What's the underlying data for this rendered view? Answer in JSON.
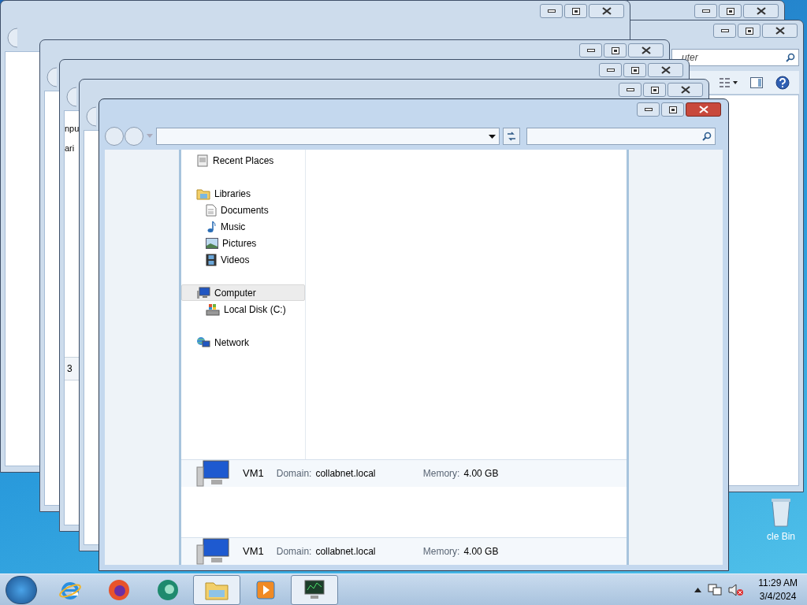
{
  "desktop": {
    "icons": [
      {
        "label": "cle Bin"
      }
    ]
  },
  "back_windows": [
    {
      "kind": "plain"
    },
    {
      "kind": "search",
      "search_placeholder": "uter"
    },
    {
      "kind": "plain"
    },
    {
      "kind": "plain"
    },
    {
      "kind": "fragments",
      "nav_fragments": [
        "npu",
        "ari"
      ],
      "status_fragment": "3"
    },
    {
      "kind": "plain"
    }
  ],
  "front_window": {
    "nav": [
      {
        "label": "Recent Places",
        "kind": "recent",
        "selected": false
      },
      {
        "label": "Libraries",
        "kind": "library",
        "selected": false,
        "children": [
          {
            "label": "Documents",
            "kind": "document",
            "selected": false
          },
          {
            "label": "Music",
            "kind": "music",
            "selected": false
          },
          {
            "label": "Pictures",
            "kind": "pictures",
            "selected": false
          },
          {
            "label": "Videos",
            "kind": "videos",
            "selected": false
          }
        ]
      },
      {
        "label": "Computer",
        "kind": "computer",
        "selected": true,
        "children": [
          {
            "label": "Local Disk (C:)",
            "kind": "disk",
            "selected": false
          }
        ]
      },
      {
        "label": "Network",
        "kind": "network",
        "selected": false
      }
    ],
    "details_panes": [
      {
        "name": "VM1",
        "domain_label": "Domain:",
        "domain": "collabnet.local",
        "memory_label": "Memory:",
        "memory": "4.00 GB"
      },
      {
        "name": "VM1",
        "domain_label": "Domain:",
        "domain": "collabnet.local",
        "memory_label": "Memory:",
        "memory": "4.00 GB"
      }
    ]
  },
  "taskbar": {
    "items": [
      {
        "kind": "ie",
        "selected": false
      },
      {
        "kind": "firefox",
        "selected": false
      },
      {
        "kind": "app",
        "selected": false
      },
      {
        "kind": "explorer",
        "selected": true
      },
      {
        "kind": "media",
        "selected": false
      },
      {
        "kind": "monitor",
        "selected": true
      }
    ],
    "clock": {
      "time": "11:29 AM",
      "date": "3/4/2024"
    }
  }
}
